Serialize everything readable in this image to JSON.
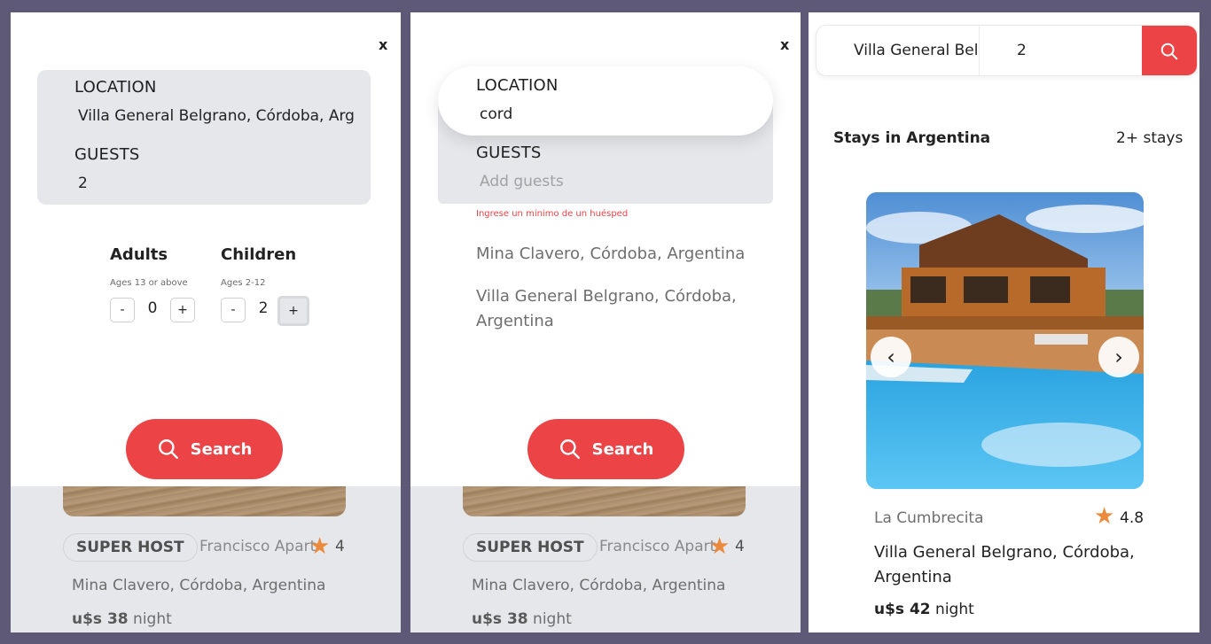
{
  "panel1": {
    "close_label": "x",
    "location_label": "LOCATION",
    "location_value": "Villa General Belgrano, Córdoba, Argentina",
    "guests_label": "GUESTS",
    "guests_value": "2",
    "adults_title": "Adults",
    "adults_sub": "Ages 13 or above",
    "adults_count": "0",
    "children_title": "Children",
    "children_sub": "Ages 2-12",
    "children_count": "2",
    "minus_label": "-",
    "plus_label": "+",
    "search_label": "Search"
  },
  "panel2": {
    "close_label": "x",
    "location_label": "LOCATION",
    "location_value": "cord",
    "guests_label": "GUESTS",
    "guests_placeholder": "Add guests",
    "error_text": "Ingrese un minimo de un huésped",
    "suggestions": [
      "Mina Clavero, Córdoba, Argentina",
      "Villa General Belgrano, Córdoba, Argentina"
    ],
    "search_label": "Search"
  },
  "underlay": {
    "superhost_label": "SUPER HOST",
    "apartment_name": "Francisco Apart",
    "rating": "4",
    "location": "Mina Clavero, Córdoba, Argentina",
    "price": "u$s 38",
    "price_unit": "night"
  },
  "panel3": {
    "search_location": "Villa General Belgrano",
    "search_guests": "2",
    "stays_title": "Stays in Argentina",
    "stays_count": "2+ stays",
    "card": {
      "town": "La Cumbrecita",
      "rating": "4.8",
      "location": "Villa General Belgrano, Córdoba, Argentina",
      "price": "u$s 42",
      "price_unit": "night"
    },
    "prev_icon": "chevron-left-icon",
    "next_icon": "chevron-right-icon"
  },
  "colors": {
    "accent": "#eb4346",
    "star": "#eb8a3c",
    "field_bg": "#e6e7eb",
    "frame_bg": "#5d5977"
  }
}
